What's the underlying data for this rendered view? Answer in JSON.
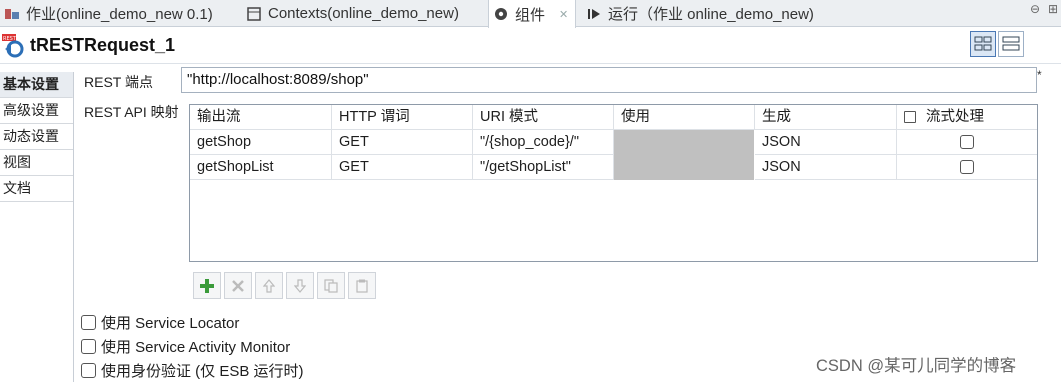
{
  "tabs": [
    {
      "label": "作业(online_demo_new 0.1)",
      "icon": "job-icon"
    },
    {
      "label": "Contexts(online_demo_new)",
      "icon": "contexts-icon"
    },
    {
      "label": "组件",
      "icon": "component-icon"
    },
    {
      "label": "运行（作业 online_demo_new)",
      "icon": "run-icon"
    }
  ],
  "component": {
    "title": "tRESTRequest_1",
    "icon": "rest-component-icon"
  },
  "sidebar": {
    "items": [
      {
        "label": "基本设置",
        "active": true
      },
      {
        "label": "高级设置"
      },
      {
        "label": "动态设置"
      },
      {
        "label": "视图"
      },
      {
        "label": "文档"
      }
    ]
  },
  "basic": {
    "endpoint_label": "REST 端点",
    "endpoint_value": "\"http://localhost:8089/shop\"",
    "required_mark": "*",
    "mapping_label": "REST API 映射"
  },
  "mapping_table": {
    "columns": [
      "输出流",
      "HTTP 谓词",
      "URI 模式",
      "使用",
      "生成",
      "流式处理"
    ],
    "rows": [
      {
        "output": "getShop",
        "verb": "GET",
        "uri": "\"/{shop_code}/\"",
        "use": "",
        "produces": "JSON",
        "streaming": false
      },
      {
        "output": "getShopList",
        "verb": "GET",
        "uri": "\"/getShopList\"",
        "use": "",
        "produces": "JSON",
        "streaming": false
      }
    ]
  },
  "options": {
    "service_locator": "使用 Service Locator",
    "activity_monitor": "使用 Service Activity Monitor",
    "auth": "使用身份验证 (仅 ESB 运行时)"
  },
  "watermark": "CSDN @某可儿同学的博客",
  "colors": {
    "add_green": "#3a9a3a",
    "selected_tab": "#e8ecf1",
    "disabled_cell": "#c0c0c0"
  }
}
